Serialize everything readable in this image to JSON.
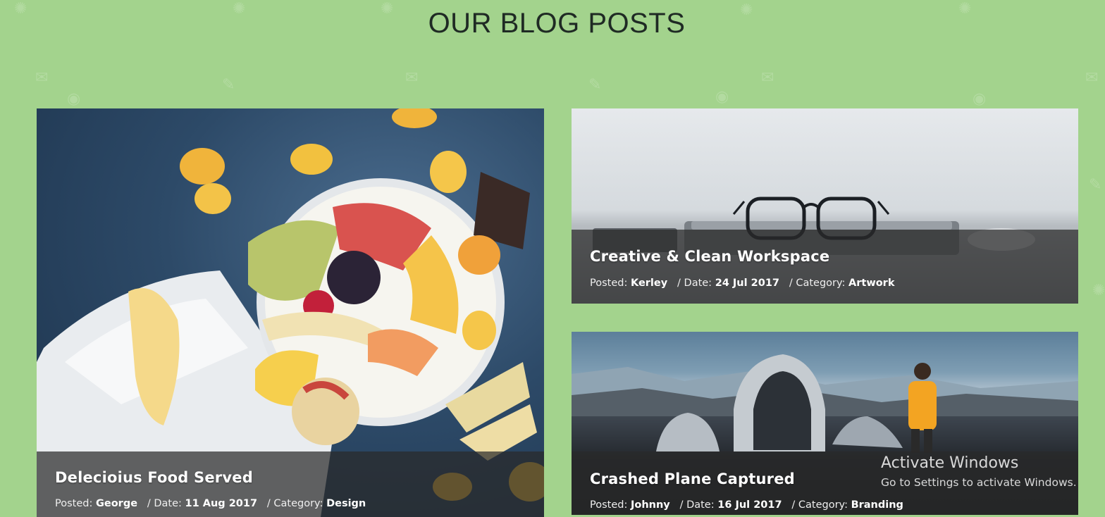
{
  "section": {
    "title": "OUR BLOG POSTS"
  },
  "posts": [
    {
      "title": "Delecioius Food Served",
      "posted_label": "Posted:",
      "author": "George",
      "date_label": "/ Date:",
      "date": "11 Aug 2017",
      "category_label": "/ Category:",
      "category": "Design"
    },
    {
      "title": "Creative & Clean Workspace",
      "posted_label": "Posted:",
      "author": "Kerley",
      "date_label": "/ Date:",
      "date": "24 Jul 2017",
      "category_label": "/ Category:",
      "category": "Artwork"
    },
    {
      "title": "Crashed Plane Captured",
      "posted_label": "Posted:",
      "author": "Johnny",
      "date_label": "/ Date:",
      "date": "16 Jul 2017",
      "category_label": "/ Category:",
      "category": "Branding"
    }
  ],
  "watermark": {
    "title": "Activate Windows",
    "subtitle": "Go to Settings to activate Windows."
  },
  "theme": {
    "background": "#a3d38d",
    "heading": "#1f2a24",
    "overlay": "#2a2a2a"
  }
}
